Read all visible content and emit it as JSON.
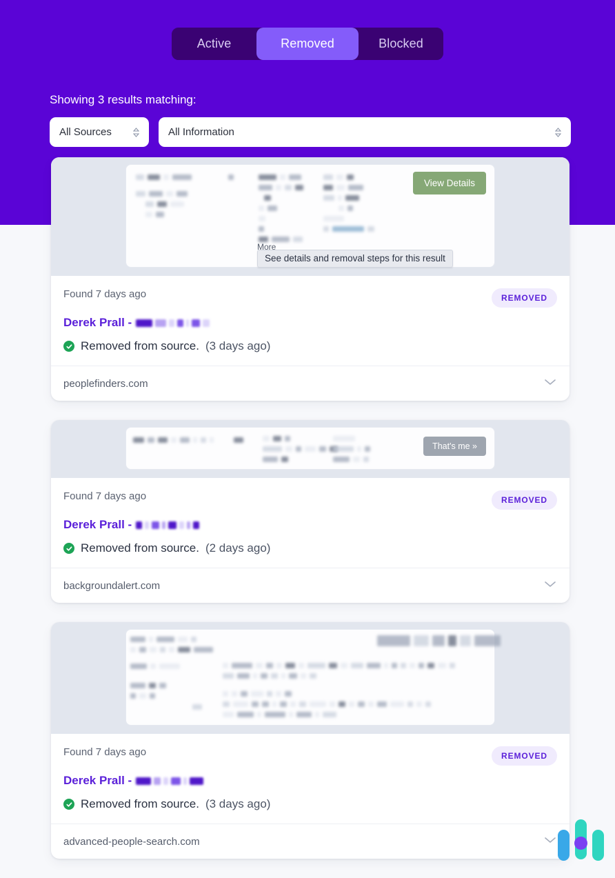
{
  "theme": {
    "brand_purple": "#5a04d6",
    "tab_track": "#3a0273",
    "tab_active": "#845cfa",
    "badge_bg": "#f0ebfd",
    "badge_text": "#5a1fd9",
    "success_green": "#1da456",
    "view_details_green": "#86a876",
    "thats_me_gray": "#9ea5af",
    "page_bg": "#f7f8fb",
    "preview_bg": "#e2e6ee"
  },
  "tabs": [
    {
      "label": "Active",
      "active": false
    },
    {
      "label": "Removed",
      "active": true
    },
    {
      "label": "Blocked",
      "active": false
    }
  ],
  "results_summary": "Showing 3 results matching:",
  "filters": {
    "sources": {
      "value": "All Sources",
      "icon": "stepper-icon"
    },
    "information": {
      "value": "All Information",
      "icon": "stepper-icon"
    }
  },
  "cards": [
    {
      "preview": {
        "action_label": "View Details",
        "action_type": "view-details",
        "more_label": "More",
        "tooltip": "See details and removal steps for this result"
      },
      "found_text": "Found 7 days ago",
      "badge": "REMOVED",
      "name": "Derek Prall -",
      "status_text": "Removed from source.",
      "status_time": "(3 days ago)",
      "source": "peoplefinders.com",
      "expand_icon": "chevron-down-icon"
    },
    {
      "preview": {
        "action_label": "That's me »",
        "action_type": "thats-me"
      },
      "found_text": "Found 7 days ago",
      "badge": "REMOVED",
      "name": "Derek Prall -",
      "status_text": "Removed from source.",
      "status_time": "(2 days ago)",
      "source": "backgroundalert.com",
      "expand_icon": "chevron-down-icon"
    },
    {
      "preview": {},
      "found_text": "Found 7 days ago",
      "badge": "REMOVED",
      "name": "Derek Prall -",
      "status_text": "Removed from source.",
      "status_time": "(3 days ago)",
      "source": "advanced-people-search.com",
      "expand_icon": "chevron-down-icon"
    }
  ],
  "widget": {
    "name": "assistant-widget",
    "colors": [
      "#39a8e8",
      "#2fd5c0",
      "#7b3ff2"
    ]
  }
}
